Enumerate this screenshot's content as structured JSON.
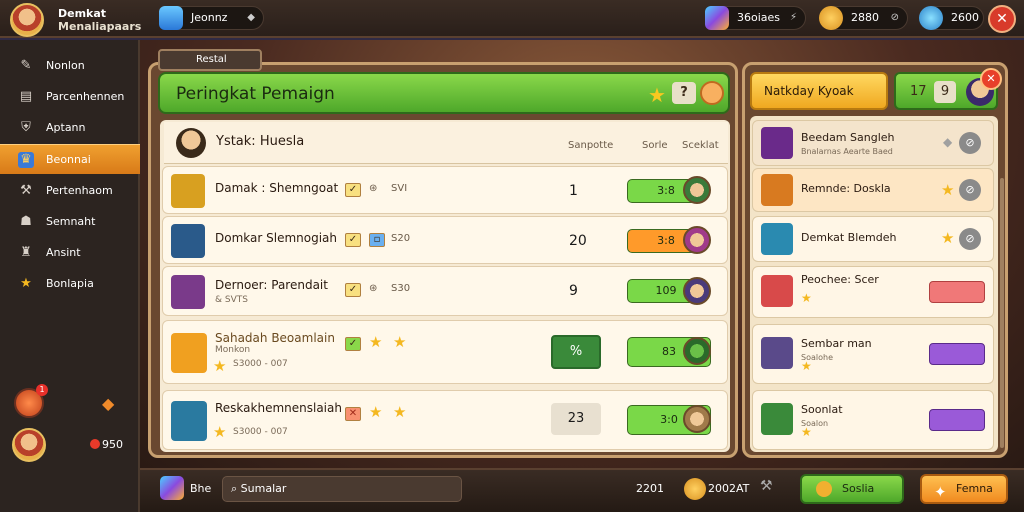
{
  "topbar": {
    "player_name": "Demkat",
    "player_sub": "Menaliapaars",
    "search_pill": "Jeonnz",
    "gems_pill": "36oiaes",
    "coins_pill": "2880",
    "energy_pill": "2600"
  },
  "sidebar": {
    "items": [
      {
        "label": "Nonlon",
        "icon": "gear-icon"
      },
      {
        "label": "Parcenhennen",
        "icon": "book-icon"
      },
      {
        "label": "Aptann",
        "icon": "shield-icon"
      },
      {
        "label": "Beonnai",
        "icon": "trophy-icon"
      },
      {
        "label": "Pertenhaom",
        "icon": "wrench-icon"
      },
      {
        "label": "Semnaht",
        "icon": "people-icon"
      },
      {
        "label": "Ansint",
        "icon": "gift-icon"
      },
      {
        "label": "Bonlapia",
        "icon": "star-icon"
      }
    ],
    "active_index": 3,
    "badge": "1",
    "coins": "950"
  },
  "main": {
    "tab_label": "Restal",
    "title": "Peringkat Pemaign",
    "question": "?",
    "header": {
      "name": "Ystak: Huesla",
      "col1": "Sanpotte",
      "col2": "Sorle",
      "col3": "Sceklat"
    },
    "rows": [
      {
        "name": "Damak : Shemngoat",
        "meta": "SVI",
        "rank": "1",
        "score": "3:8",
        "icon_color": "#d8a020",
        "bar_color": "#7ad848"
      },
      {
        "name": "Domkar  Slemnogiah",
        "meta": "S20",
        "rank": "20",
        "score": "3:8",
        "icon_color": "#2a5a8a",
        "bar_color": "#ff9a2a"
      },
      {
        "name": "Dernoer: Parendait",
        "sub": "& SVTS",
        "meta": "S30",
        "rank": "9",
        "score": "109",
        "icon_color": "#7a3a8a",
        "bar_color": "#7ad848"
      },
      {
        "name": "Sahadah Beoamlain",
        "sub": "Monkon",
        "sub2": "S3000 - 007",
        "rank": "%",
        "score": "83",
        "icon_color": "#f0a020",
        "bar_color": "#7ad848"
      },
      {
        "name": "Reskakhemnenslaiah",
        "sub2": "S3000 - 007",
        "rank": "23",
        "score": "3:0",
        "icon_color": "#2a7aa0",
        "bar_color": "#7ad848"
      }
    ]
  },
  "right": {
    "header": "Natkday Kyoak",
    "header2_a": "17",
    "header2_b": "9",
    "rows": [
      {
        "name": "Beedam Sangleh",
        "sub": "Bnalarnas Aearte Baed",
        "icon_color": "#6a2a8a"
      },
      {
        "name": "Remnde: Doskla",
        "icon_color": "#d87a20"
      },
      {
        "name": "Demkat Blemdeh",
        "icon_color": "#2a8ab0"
      },
      {
        "name": "Peochee: Scer",
        "icon_color": "#d84a4a"
      },
      {
        "name": "Sembar man",
        "sub": "Soalohe",
        "icon_color": "#5a4a8a"
      },
      {
        "name": "Soonlat",
        "sub": "Soalon",
        "icon_color": "#3a8a3a"
      }
    ]
  },
  "bottom": {
    "label": "Bhe",
    "search_placeholder": "Sumalar",
    "count": "2201",
    "coins": "2002AT",
    "btn_green": "Soslia",
    "btn_orange": "Femna"
  }
}
